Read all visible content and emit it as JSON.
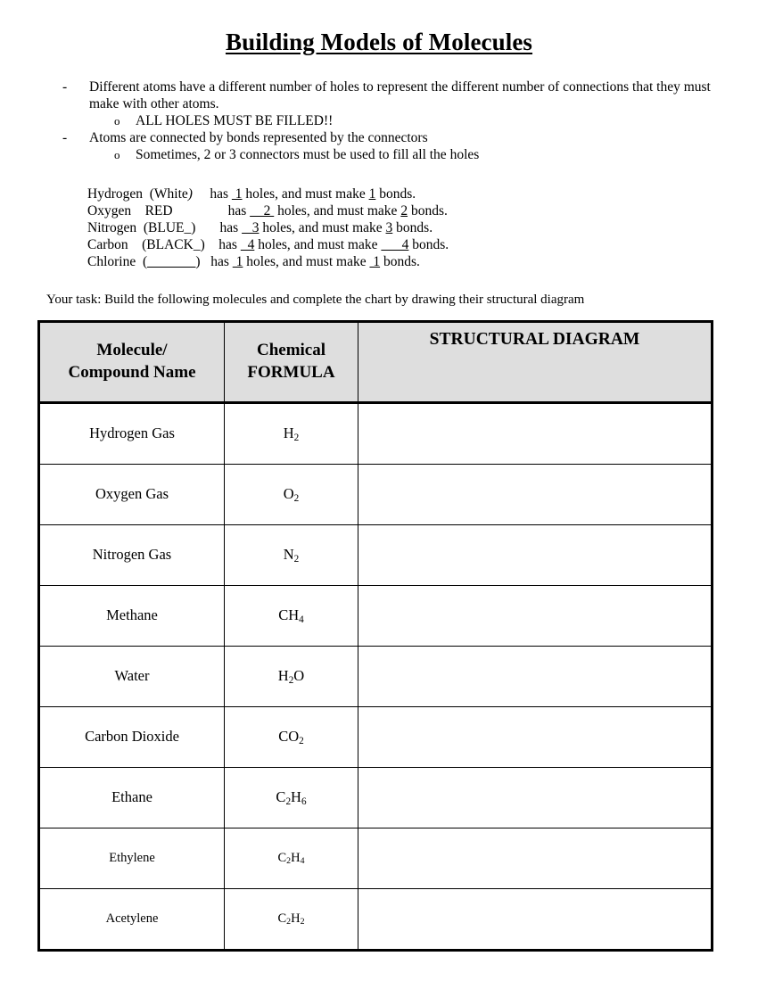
{
  "title": "Building Models of Molecules",
  "intro": {
    "bullets": [
      {
        "marker": "-",
        "level": 1,
        "text": "Different atoms have a different number of holes to represent the different number of connections that they must make with other atoms."
      },
      {
        "marker": "o",
        "level": 2,
        "text": "ALL HOLES MUST BE FILLED!!"
      },
      {
        "marker": "-",
        "level": 1,
        "text": "Atoms are connected by bonds represented by the connectors"
      },
      {
        "marker": "o",
        "level": 2,
        "text": "Sometimes, 2 or 3 connectors must be used to fill all the holes"
      }
    ]
  },
  "elements": {
    "rows": [
      {
        "name": "Hydrogen",
        "color_open": "(White",
        "color_close": ")",
        "color_close_italic": true,
        "pre_has_pad": " ",
        "has_word": "has",
        "holes_pad": " ",
        "holes": "1",
        "holes_text": " holes, and must make ",
        "bonds": "1",
        "bonds_text": " bonds."
      },
      {
        "name": "Oxygen",
        "color_open": "RED",
        "color_close": "",
        "color_close_italic": false,
        "pre_has_pad": "        ",
        "has_word": "has",
        "holes_pad": "    ",
        "holes": "2 ",
        "holes_text": " holes, and must make ",
        "bonds": "2",
        "bonds_text": " bonds."
      },
      {
        "name": "Nitrogen",
        "color_open": "(BLUE_",
        "color_close": ")",
        "color_close_italic": false,
        "pre_has_pad": "   ",
        "has_word": "has",
        "holes_pad": "   ",
        "holes": "3",
        "holes_text": " holes, and must make ",
        "bonds": "3",
        "bonds_text": " bonds."
      },
      {
        "name": "Carbon",
        "color_open": "(BLACK_",
        "color_close": ")",
        "color_close_italic": false,
        "pre_has_pad": " ",
        "has_word": "has",
        "holes_pad": "  ",
        "holes": "4",
        "holes_text": " holes, and must make ",
        "bonds": "      4",
        "bonds_text": " bonds."
      },
      {
        "name": "Chlorine",
        "color_open": "(",
        "color_close": ")",
        "color_close_italic": false,
        "blank_inside_paren": "_______",
        "pre_has_pad": " ",
        "has_word": "has",
        "holes_pad": " ",
        "holes": "1",
        "holes_text": " holes, and must make ",
        "bonds": " 1",
        "bonds_text": " bonds."
      }
    ]
  },
  "task": {
    "text": "Your task: Build the following molecules and complete the chart by drawing their structural diagram"
  },
  "chart": {
    "headers": {
      "name_line1": "Molecule/",
      "name_line2": "Compound Name",
      "formula_line1": "Chemical",
      "formula_line2": "FORMULA",
      "diagram": "STRUCTURAL DIAGRAM"
    },
    "header_bg": "#dedede",
    "rows": [
      {
        "name": "Hydrogen Gas",
        "formula_base": "H",
        "formula_sub": "2",
        "formula_tail": "",
        "diagram": "",
        "small": false
      },
      {
        "name": "Oxygen Gas",
        "formula_base": "O",
        "formula_sub": "2",
        "formula_tail": "",
        "diagram": "",
        "small": false
      },
      {
        "name": "Nitrogen Gas",
        "formula_base": "N",
        "formula_sub": "2",
        "formula_tail": "",
        "diagram": "",
        "small": false
      },
      {
        "name": "Methane",
        "formula_base": "CH",
        "formula_sub": "4",
        "formula_tail": "",
        "diagram": "",
        "small": false
      },
      {
        "name": "Water",
        "formula_base": "H",
        "formula_sub": "2",
        "formula_tail": "O",
        "diagram": "",
        "small": false
      },
      {
        "name": "Carbon Dioxide",
        "formula_base": "CO",
        "formula_sub": "2",
        "formula_tail": "",
        "diagram": "",
        "small": false
      },
      {
        "name": "Ethane",
        "formula_base": "C",
        "formula_sub": "2",
        "formula_tail": "H",
        "formula_sub2": "6",
        "diagram": "",
        "small": false
      },
      {
        "name": "Ethylene",
        "formula_base": "C",
        "formula_sub": "2",
        "formula_tail": "H",
        "formula_sub2": "4",
        "diagram": "",
        "small": true
      },
      {
        "name": "Acetylene",
        "formula_base": "C",
        "formula_sub": "2",
        "formula_tail": "H",
        "formula_sub2": "2",
        "diagram": "",
        "small": true
      }
    ]
  }
}
